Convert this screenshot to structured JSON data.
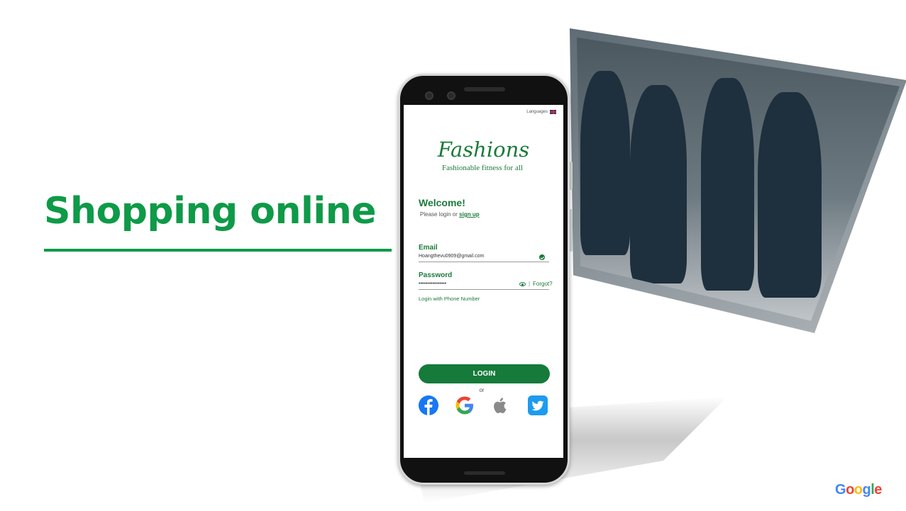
{
  "slide": {
    "title": "Shopping online"
  },
  "app": {
    "languages_label": "Languages",
    "brand_name": "Fashions",
    "tagline": "Fashionable fitness for all",
    "welcome_heading": "Welcome!",
    "subtext_prefix": "Please login or",
    "signup_link": "sign up",
    "email_label": "Email",
    "email_value": "Hoangthevu0909@gmail.com",
    "password_label": "Password",
    "password_value": "••••••••••••••••",
    "forgot_link": "Forgot?",
    "separator": "|",
    "phone_login_link": "Login with Phone Number",
    "login_button": "LOGIN",
    "or_text": "or",
    "social_buttons": [
      "facebook-icon",
      "google-icon",
      "apple-icon",
      "twitter-icon"
    ]
  },
  "footer": {
    "logo_text": "Google"
  },
  "colors": {
    "brand_green": "#0e9a48",
    "app_green": "#157a3a",
    "facebook_blue": "#1877f2",
    "twitter_blue": "#1d9bf0"
  }
}
